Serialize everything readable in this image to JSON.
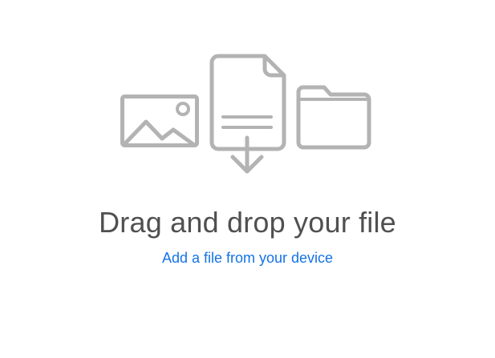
{
  "drop_zone": {
    "icons": [
      "image-icon",
      "file-upload-icon",
      "folder-icon"
    ],
    "icon_color": "#b3b3b3",
    "headline": "Drag and drop your file",
    "add_file_link": "Add a file from your device",
    "link_color": "#1473e6",
    "text_color": "#505050"
  }
}
